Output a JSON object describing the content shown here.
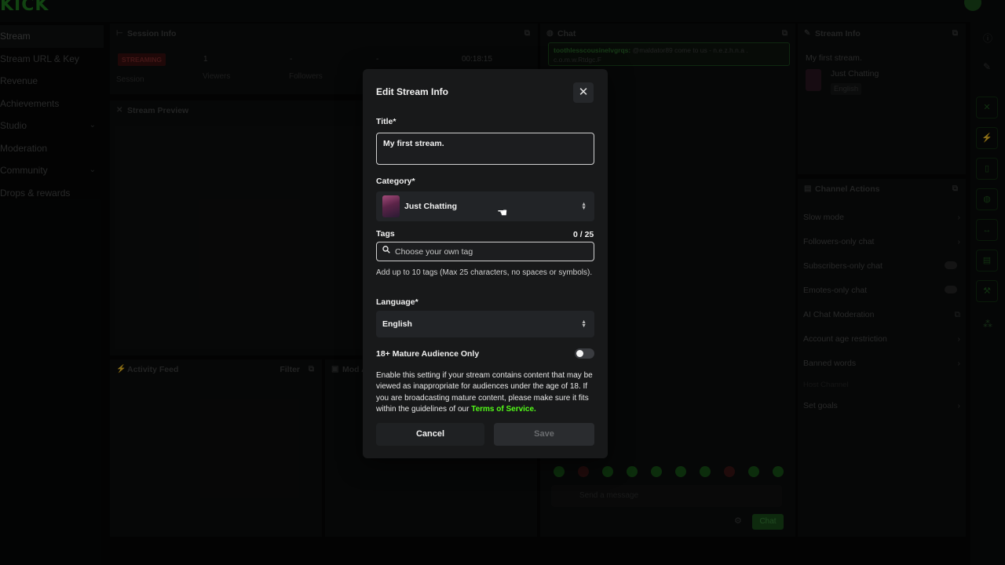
{
  "app": {
    "logo": "KICK"
  },
  "sidebar": {
    "items": [
      {
        "label": "Stream",
        "active": true
      },
      {
        "label": "Stream URL & Key"
      },
      {
        "label": "Revenue"
      },
      {
        "label": "Achievements"
      },
      {
        "label": "Studio",
        "expandable": true
      },
      {
        "label": "Moderation"
      },
      {
        "label": "Community",
        "expandable": true
      },
      {
        "label": "Drops & rewards"
      }
    ]
  },
  "session_info": {
    "title": "Session Info",
    "badge": "STREAMING",
    "stats": [
      {
        "value": "",
        "label": "Session"
      },
      {
        "value": "1",
        "label": "Viewers"
      },
      {
        "value": "-",
        "label": "Followers"
      },
      {
        "value": "-",
        "label": ""
      },
      {
        "value": "00:18:15",
        "label": ""
      }
    ]
  },
  "stream_preview": {
    "title": "Stream Preview"
  },
  "activity_feed": {
    "title": "Activity Feed",
    "filter": "Filter"
  },
  "mod_actions": {
    "title": "Mod A"
  },
  "chat": {
    "title": "Chat",
    "pinned_user": "toothlesscousinelvgrqs:",
    "pinned_text": "@maldator89 come to us - n.e.z.h.n.a . c.o.m.w.Rtdgc.F",
    "input_placeholder": "Send a message",
    "send_label": "Chat"
  },
  "stream_info": {
    "title": "Stream Info",
    "stream_title": "My first stream.",
    "category": "Just Chatting",
    "language": "English"
  },
  "channel_actions": {
    "title": "Channel Actions",
    "items": [
      {
        "label": "Slow mode",
        "control": "chevron"
      },
      {
        "label": "Followers-only chat",
        "control": "chevron"
      },
      {
        "label": "Subscribers-only chat",
        "control": "toggle"
      },
      {
        "label": "Emotes-only chat",
        "control": "toggle"
      },
      {
        "label": "AI Chat Moderation",
        "control": "external"
      },
      {
        "label": "Account age restriction",
        "control": "chevron"
      },
      {
        "label": "Banned words",
        "control": "chevron"
      },
      {
        "label": "Host Channel",
        "control": "none"
      },
      {
        "label": "Set goals",
        "control": "chevron"
      }
    ]
  },
  "modal": {
    "title": "Edit Stream Info",
    "title_label": "Title*",
    "title_value": "My first stream.",
    "category_label": "Category*",
    "category_value": "Just Chatting",
    "tags_label": "Tags",
    "tags_count": "0 / 25",
    "tags_placeholder": "Choose your own tag",
    "tags_help": "Add up to 10 tags (Max 25 characters, no spaces or symbols).",
    "language_label": "Language*",
    "language_value": "English",
    "mature_label": "18+ Mature Audience Only",
    "mature_enabled": false,
    "mature_text": "Enable this setting if your stream contains content that may be viewed as inappropriate for audiences under the age of 18. If you are broadcasting mature content, please make sure it fits within the guidelines of our",
    "tos_link": "Terms of Service.",
    "cancel_label": "Cancel",
    "save_label": "Save"
  },
  "colors": {
    "accent": "#53fc18",
    "modal_bg": "#18191a",
    "page_bg": "#060707"
  }
}
